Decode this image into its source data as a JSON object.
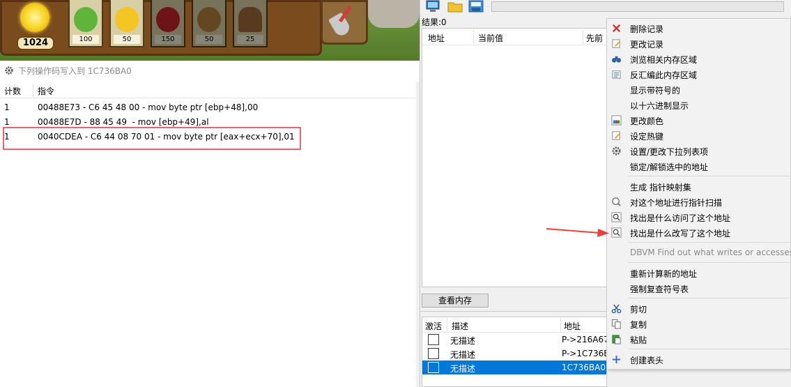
{
  "game": {
    "sun_count": "1024",
    "cards": [
      {
        "name": "peashooter",
        "cost": "100"
      },
      {
        "name": "sunflower",
        "cost": "50"
      },
      {
        "name": "cherry-bomb",
        "cost": "150"
      },
      {
        "name": "wall-nut",
        "cost": "50"
      },
      {
        "name": "potato-mine",
        "cost": "25"
      }
    ]
  },
  "left_window": {
    "title": "下列操作码写入到 1C736BA0",
    "columns": [
      "计数",
      "指令"
    ],
    "rows": [
      {
        "count": "1",
        "instruction": "00488E73 - C6 45 48 00 - mov byte ptr [ebp+48],00"
      },
      {
        "count": "1",
        "instruction": "00488E7D - 88 45 49  - mov [ebp+49],al"
      },
      {
        "count": "1",
        "instruction": "0040CDEA - C6 44 08 70 01 - mov byte ptr [eax+ecx+70],01"
      }
    ]
  },
  "ce": {
    "results_label": "结果:0",
    "results_columns": [
      "地址",
      "当前值",
      "先前"
    ],
    "view_memory_button": "查看内存",
    "address_list_columns": [
      "激活",
      "描述",
      "地址"
    ],
    "address_rows": [
      {
        "desc": "无描述",
        "address": "P->216A67",
        "selected": false
      },
      {
        "desc": "无描述",
        "address": "P->1C736B",
        "selected": false
      },
      {
        "desc": "无描述",
        "address": "1C736BA0",
        "selected": true
      }
    ]
  },
  "context_menu": {
    "items": [
      {
        "label": "删除记录",
        "icon": "delete-icon"
      },
      {
        "label": "更改记录",
        "icon": "edit-icon"
      },
      {
        "label": "浏览相关内存区域",
        "icon": "binoculars-icon"
      },
      {
        "label": "反汇编此内存区域",
        "icon": "disassemble-icon"
      },
      {
        "label": "显示带符号的",
        "icon": ""
      },
      {
        "label": "以十六进制显示",
        "icon": ""
      },
      {
        "label": "更改颜色",
        "icon": "palette-icon"
      },
      {
        "label": "设定热键",
        "icon": "hotkey-icon"
      },
      {
        "label": "设置/更改下拉列表项",
        "icon": "gear-icon"
      },
      {
        "label": "锁定/解锁选中的地址",
        "icon": ""
      },
      {
        "label": "生成 指针映射集",
        "icon": ""
      },
      {
        "label": "对这个地址进行指针扫描",
        "icon": "pointer-scan-icon"
      },
      {
        "label": "找出是什么访问了这个地址",
        "icon": "find-access-icon"
      },
      {
        "label": "找出是什么改写了这个地址",
        "icon": "find-write-icon"
      },
      {
        "label": "DBVM Find out what writes or accesses",
        "icon": ""
      },
      {
        "label": "重新计算新的地址",
        "icon": ""
      },
      {
        "label": "强制复查符号表",
        "icon": ""
      },
      {
        "label": "剪切",
        "icon": "scissors-icon"
      },
      {
        "label": "复制",
        "icon": "copy-icon"
      },
      {
        "label": "粘贴",
        "icon": "paste-icon"
      },
      {
        "label": "创建表头",
        "icon": "plus-icon"
      }
    ]
  },
  "colors": {
    "selection": "#0078d7",
    "highlight_box": "#e4686a",
    "arrow": "#e8413c"
  }
}
